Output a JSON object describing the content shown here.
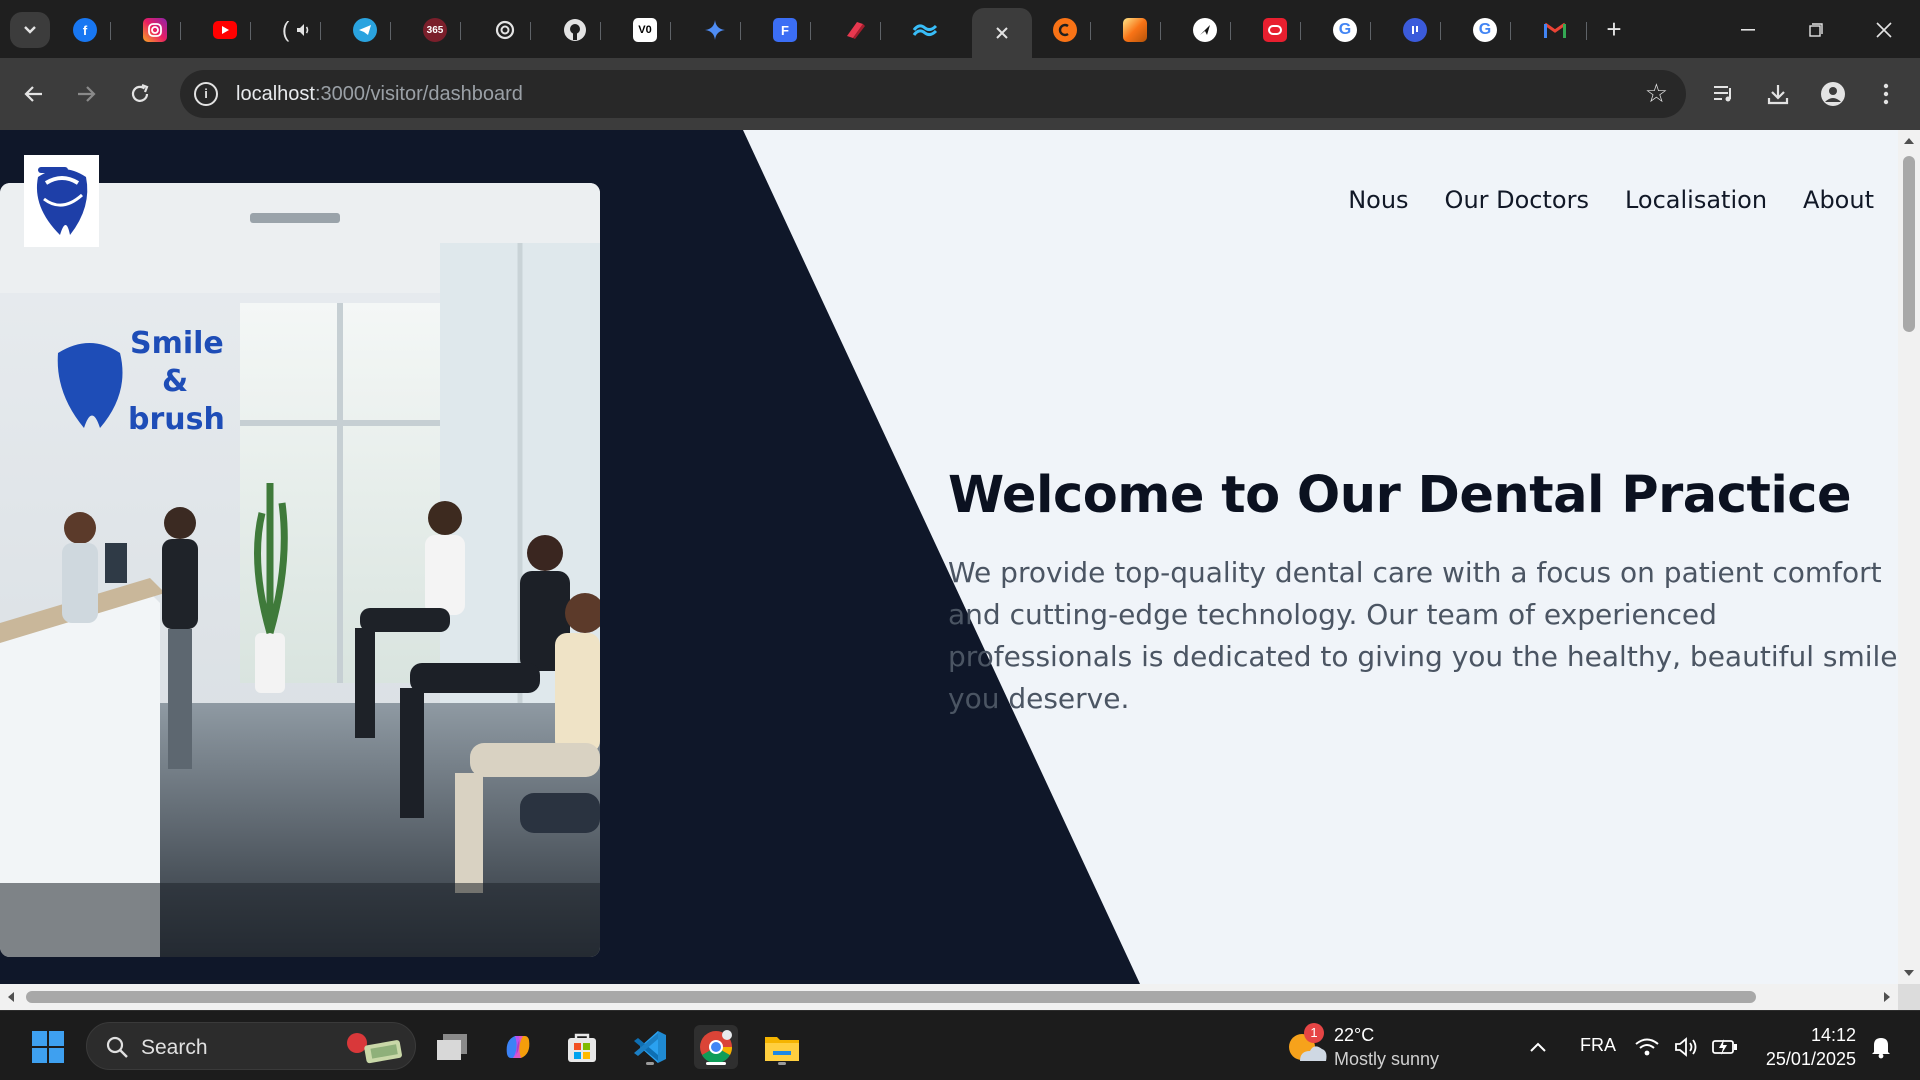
{
  "browser": {
    "url": {
      "host": "localhost",
      "path": ":3000/visitor/dashboard"
    },
    "tab_favicons": [
      "facebook-icon",
      "instagram-icon",
      "youtube-icon",
      "audio-playing-tab-icon",
      "telegram-icon",
      "office-365-icon",
      "openai-icon",
      "github-icon",
      "vercel-icon",
      "gemini-icon",
      "forms-icon",
      "shield-icon",
      "tailwind-icon",
      "close-icon",
      "claude-icon",
      "photo-app-icon",
      "send-icon",
      "opera-icon",
      "google-icon",
      "podcast-icon",
      "google-icon",
      "gmail-icon"
    ],
    "tab_badge_365": "365"
  },
  "site": {
    "nav": [
      "Nous",
      "Our Doctors",
      "Localisation",
      "About"
    ],
    "hero": {
      "title": "Welcome to Our Dental Practice",
      "text": "We provide top-quality dental care with a focus on patient comfort and cutting-edge technology. Our team of experienced professionals is dedicated to giving you the healthy, beautiful smile you deserve."
    },
    "photo_sign": {
      "line1": "Smile",
      "line2": "&",
      "line3": "brush"
    },
    "colors": {
      "dark_navy": "#0f1729",
      "light_panel": "#f0f4f9",
      "brand_blue": "#1e4db7"
    }
  },
  "taskbar": {
    "search_label": "Search",
    "weather": {
      "badge": "1",
      "temp": "22°C",
      "condition": "Mostly sunny"
    },
    "language": "FRA",
    "time": "14:12",
    "date": "25/01/2025"
  }
}
